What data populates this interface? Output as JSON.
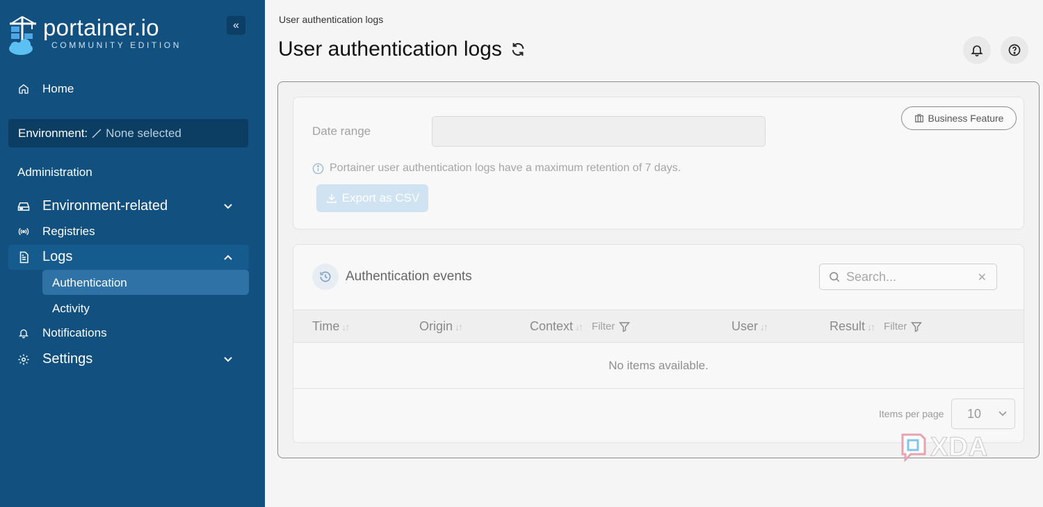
{
  "sidebar": {
    "logo": {
      "name": "portainer.io",
      "edition": "COMMUNITY EDITION"
    },
    "collapse_glyph": "«",
    "home_label": "Home",
    "environment": {
      "label": "Environment:",
      "value": "None selected"
    },
    "section_title": "Administration",
    "items": [
      {
        "label": "Environment-related",
        "icon": "server-icon",
        "expanded": false
      },
      {
        "label": "Registries",
        "icon": "broadcast-icon"
      },
      {
        "label": "Logs",
        "icon": "file-text-icon",
        "expanded": true
      },
      {
        "label": "Notifications",
        "icon": "bell-icon"
      },
      {
        "label": "Settings",
        "icon": "gear-icon",
        "expanded": false
      }
    ],
    "logs_sub": [
      {
        "label": "Authentication",
        "active": true
      },
      {
        "label": "Activity",
        "active": false
      }
    ]
  },
  "header": {
    "breadcrumb": "User authentication logs",
    "title": "User authentication logs"
  },
  "filters": {
    "business_badge": "Business Feature",
    "date_range_label": "Date range",
    "date_range_value": "",
    "info_text": "Portainer user authentication logs have a maximum retention of 7 days.",
    "export_label": "Export as CSV"
  },
  "events": {
    "title": "Authentication events",
    "search_placeholder": "Search...",
    "columns": [
      {
        "label": "Time",
        "filter": false
      },
      {
        "label": "Origin",
        "filter": false
      },
      {
        "label": "Context",
        "filter": true
      },
      {
        "label": "User",
        "filter": false
      },
      {
        "label": "Result",
        "filter": true
      }
    ],
    "filter_label": "Filter",
    "empty_text": "No items available.",
    "items_per_page_label": "Items per page",
    "items_per_page_value": "10"
  },
  "watermark": "XDA",
  "colors": {
    "sidebar_bg": "#11507f",
    "active_item": "#2f72a5",
    "export_button": "#cfe3f2"
  }
}
